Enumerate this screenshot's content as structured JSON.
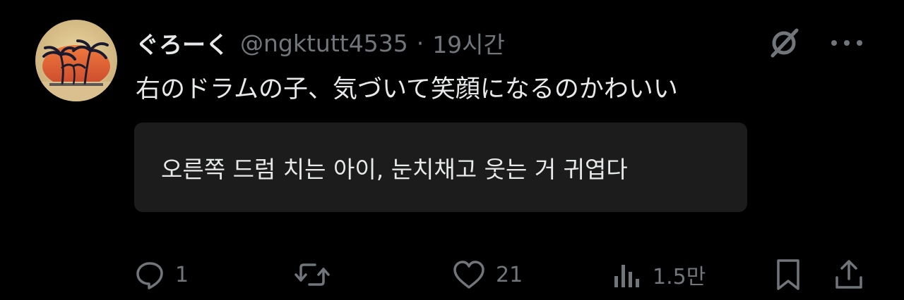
{
  "author": {
    "display_name": "ぐろーく",
    "handle": "@ngktutt4535",
    "separator": "·",
    "time": "19시간"
  },
  "tweet": {
    "text": "右のドラムの子、気づいて笑顔になるのかわいい",
    "translation": "오른쪽 드럼 치는 아이, 눈치채고 웃는 거 귀엽다"
  },
  "metrics": {
    "replies": "1",
    "likes": "21",
    "views": "1.5만"
  },
  "colors": {
    "background": "#000000",
    "primary_text": "#e7e9ea",
    "secondary_text": "#71767b",
    "translation_box": "#1c1c1c"
  },
  "icons": [
    "grok-icon",
    "more-icon",
    "reply-icon",
    "retweet-icon",
    "like-icon",
    "views-icon",
    "bookmark-icon",
    "share-icon"
  ]
}
